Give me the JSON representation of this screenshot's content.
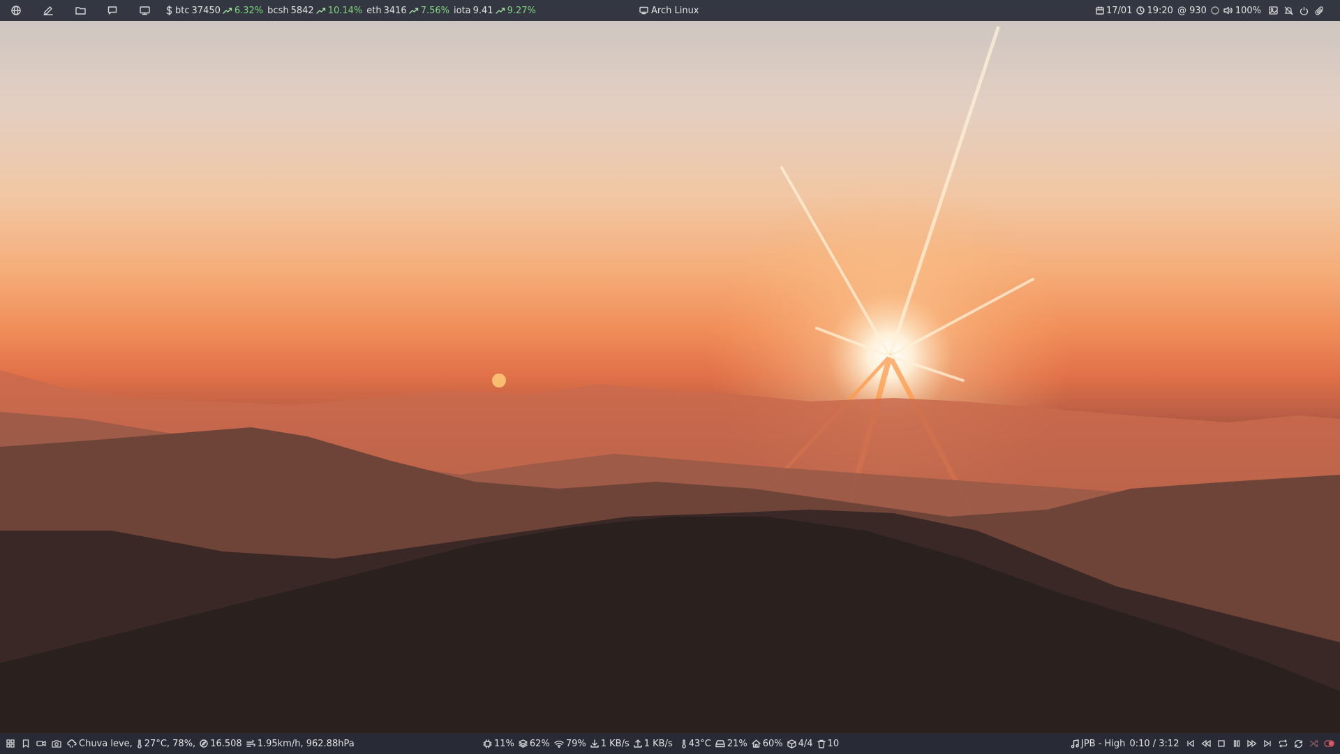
{
  "top_bar": {
    "launchers": [
      "globe-icon",
      "edit-icon",
      "folder-icon",
      "chat-icon",
      "monitor-icon"
    ],
    "crypto": [
      {
        "name": "btc",
        "price": "37450",
        "change": "6.32%"
      },
      {
        "name": "bcsh",
        "price": "5842",
        "change": "10.14%"
      },
      {
        "name": "eth",
        "price": "3416",
        "change": "7.56%"
      },
      {
        "name": "iota",
        "price": "9.41",
        "change": "9.27%"
      }
    ],
    "window_title": "Arch Linux",
    "date": "17/01",
    "time": "19:20",
    "beats": "@ 930",
    "volume": "100%"
  },
  "bottom_bar": {
    "weather": "Chuva leve,",
    "temp_humidity": "27°C, 78%,",
    "visibility": "16.508",
    "wind_pressure": "1.95km/h, 962.88hPa",
    "cpu": "11%",
    "memory": "62%",
    "wifi": "79%",
    "download": "1 KB/s",
    "upload": "1 KB/s",
    "cpu_temp": "43°C",
    "disk": "21%",
    "home": "60%",
    "packages": "4/4",
    "trash": "10",
    "music_track": "JPB - High",
    "music_time": "0:10 / 3:12"
  },
  "colors": {
    "bar_bg": "#282c38",
    "up_green": "#7ed67e",
    "text": "#e2e2e2"
  }
}
